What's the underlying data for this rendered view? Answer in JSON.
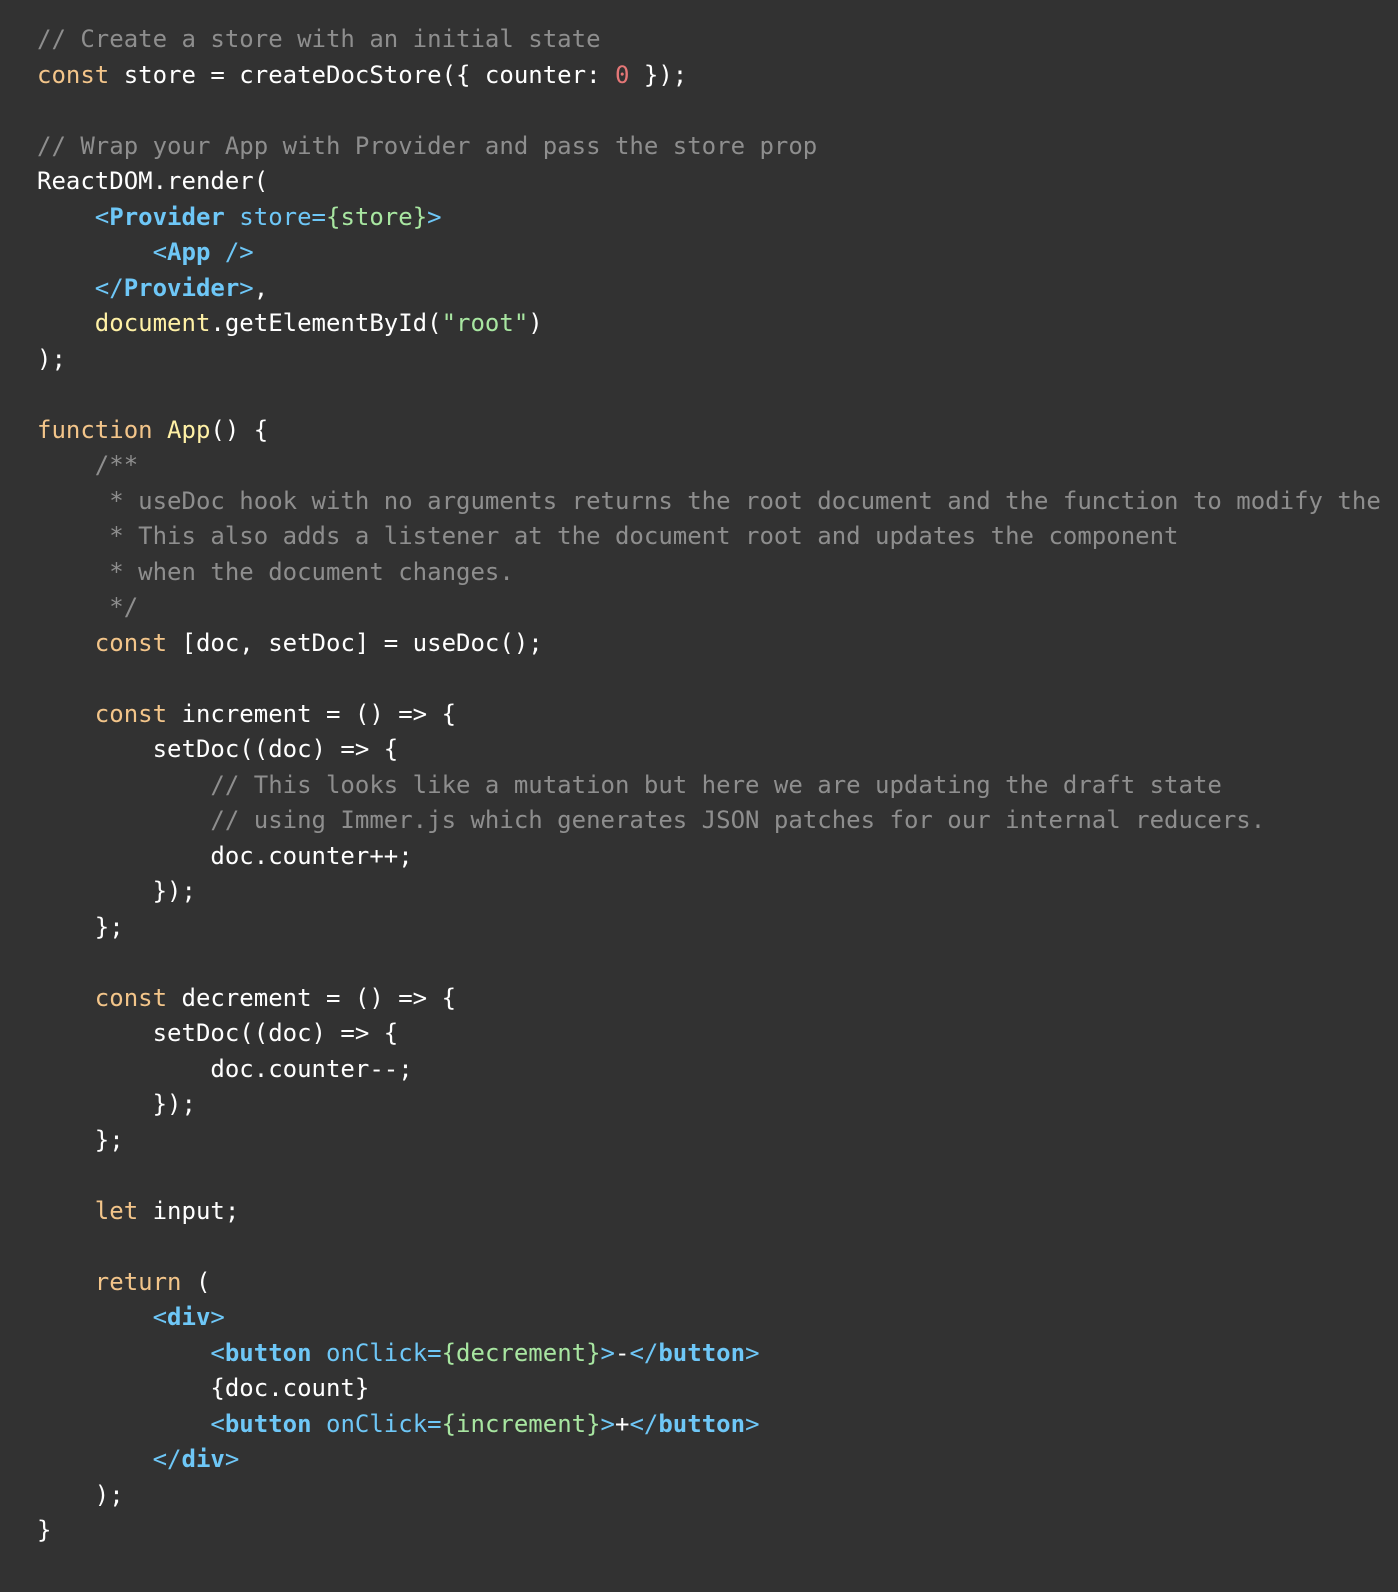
{
  "colors": {
    "background": "#323232",
    "comment": "#8e8e8e",
    "keyword": "#f3c58a",
    "text": "#ffffff",
    "number": "#e57777",
    "jsx_tag": "#6ec7f7",
    "string_attr": "#a8e6a1",
    "global": "#fff1a6"
  },
  "lines": [
    [
      {
        "t": "comment",
        "v": "// Create a store with an initial state"
      }
    ],
    [
      {
        "t": "keyword",
        "v": "const"
      },
      {
        "t": "text",
        "v": " store = createDocStore({ counter: "
      },
      {
        "t": "number",
        "v": "0"
      },
      {
        "t": "text",
        "v": " });"
      }
    ],
    [],
    [
      {
        "t": "comment",
        "v": "// Wrap your App with Provider and pass the store prop"
      }
    ],
    [
      {
        "t": "text",
        "v": "ReactDOM.render("
      }
    ],
    [
      {
        "t": "text",
        "v": "    "
      },
      {
        "t": "punct",
        "v": "<"
      },
      {
        "t": "tag",
        "v": "Provider"
      },
      {
        "t": "attr",
        "v": " store="
      },
      {
        "t": "attrval",
        "v": "{store}"
      },
      {
        "t": "punct",
        "v": ">"
      }
    ],
    [
      {
        "t": "text",
        "v": "        "
      },
      {
        "t": "punct",
        "v": "<"
      },
      {
        "t": "tag",
        "v": "App"
      },
      {
        "t": "punct",
        "v": " />"
      }
    ],
    [
      {
        "t": "text",
        "v": "    "
      },
      {
        "t": "punct",
        "v": "</"
      },
      {
        "t": "tag",
        "v": "Provider"
      },
      {
        "t": "punct",
        "v": ">"
      },
      {
        "t": "text",
        "v": ","
      }
    ],
    [
      {
        "t": "text",
        "v": "    "
      },
      {
        "t": "global",
        "v": "document"
      },
      {
        "t": "text",
        "v": ".getElementById("
      },
      {
        "t": "string",
        "v": "\"root\""
      },
      {
        "t": "text",
        "v": ")"
      }
    ],
    [
      {
        "t": "text",
        "v": ");"
      }
    ],
    [],
    [
      {
        "t": "keyword",
        "v": "function"
      },
      {
        "t": "text",
        "v": " "
      },
      {
        "t": "func",
        "v": "App"
      },
      {
        "t": "text",
        "v": "() {"
      }
    ],
    [
      {
        "t": "text",
        "v": "    "
      },
      {
        "t": "comment",
        "v": "/**"
      }
    ],
    [
      {
        "t": "text",
        "v": "    "
      },
      {
        "t": "comment",
        "v": " * useDoc hook with no arguments returns the root document and the function to modify the"
      }
    ],
    [
      {
        "t": "text",
        "v": "    "
      },
      {
        "t": "comment",
        "v": " * This also adds a listener at the document root and updates the component"
      }
    ],
    [
      {
        "t": "text",
        "v": "    "
      },
      {
        "t": "comment",
        "v": " * when the document changes."
      }
    ],
    [
      {
        "t": "text",
        "v": "    "
      },
      {
        "t": "comment",
        "v": " */"
      }
    ],
    [
      {
        "t": "text",
        "v": "    "
      },
      {
        "t": "keyword",
        "v": "const"
      },
      {
        "t": "text",
        "v": " [doc, setDoc] = useDoc();"
      }
    ],
    [],
    [
      {
        "t": "text",
        "v": "    "
      },
      {
        "t": "keyword",
        "v": "const"
      },
      {
        "t": "text",
        "v": " increment = () => {"
      }
    ],
    [
      {
        "t": "text",
        "v": "        setDoc((doc) => {"
      }
    ],
    [
      {
        "t": "text",
        "v": "            "
      },
      {
        "t": "comment",
        "v": "// This looks like a mutation but here we are updating the draft state"
      }
    ],
    [
      {
        "t": "text",
        "v": "            "
      },
      {
        "t": "comment",
        "v": "// using Immer.js which generates JSON patches for our internal reducers."
      }
    ],
    [
      {
        "t": "text",
        "v": "            doc.counter++;"
      }
    ],
    [
      {
        "t": "text",
        "v": "        });"
      }
    ],
    [
      {
        "t": "text",
        "v": "    };"
      }
    ],
    [],
    [
      {
        "t": "text",
        "v": "    "
      },
      {
        "t": "keyword",
        "v": "const"
      },
      {
        "t": "text",
        "v": " decrement = () => {"
      }
    ],
    [
      {
        "t": "text",
        "v": "        setDoc((doc) => {"
      }
    ],
    [
      {
        "t": "text",
        "v": "            doc.counter--;"
      }
    ],
    [
      {
        "t": "text",
        "v": "        });"
      }
    ],
    [
      {
        "t": "text",
        "v": "    };"
      }
    ],
    [],
    [
      {
        "t": "text",
        "v": "    "
      },
      {
        "t": "keyword",
        "v": "let"
      },
      {
        "t": "text",
        "v": " input;"
      }
    ],
    [],
    [
      {
        "t": "text",
        "v": "    "
      },
      {
        "t": "keyword",
        "v": "return"
      },
      {
        "t": "text",
        "v": " ("
      }
    ],
    [
      {
        "t": "text",
        "v": "        "
      },
      {
        "t": "punct",
        "v": "<"
      },
      {
        "t": "tag",
        "v": "div"
      },
      {
        "t": "punct",
        "v": ">"
      }
    ],
    [
      {
        "t": "text",
        "v": "            "
      },
      {
        "t": "punct",
        "v": "<"
      },
      {
        "t": "tag",
        "v": "button"
      },
      {
        "t": "attr",
        "v": " onClick="
      },
      {
        "t": "attrval",
        "v": "{decrement}"
      },
      {
        "t": "punct",
        "v": ">"
      },
      {
        "t": "text",
        "v": "-"
      },
      {
        "t": "punct",
        "v": "</"
      },
      {
        "t": "tag",
        "v": "button"
      },
      {
        "t": "punct",
        "v": ">"
      }
    ],
    [
      {
        "t": "text",
        "v": "            {doc.count}"
      }
    ],
    [
      {
        "t": "text",
        "v": "            "
      },
      {
        "t": "punct",
        "v": "<"
      },
      {
        "t": "tag",
        "v": "button"
      },
      {
        "t": "attr",
        "v": " onClick="
      },
      {
        "t": "attrval",
        "v": "{increment}"
      },
      {
        "t": "punct",
        "v": ">"
      },
      {
        "t": "text",
        "v": "+"
      },
      {
        "t": "punct",
        "v": "</"
      },
      {
        "t": "tag",
        "v": "button"
      },
      {
        "t": "punct",
        "v": ">"
      }
    ],
    [
      {
        "t": "text",
        "v": "        "
      },
      {
        "t": "punct",
        "v": "</"
      },
      {
        "t": "tag",
        "v": "div"
      },
      {
        "t": "punct",
        "v": ">"
      }
    ],
    [
      {
        "t": "text",
        "v": "    );"
      }
    ],
    [
      {
        "t": "text",
        "v": "}"
      }
    ]
  ]
}
